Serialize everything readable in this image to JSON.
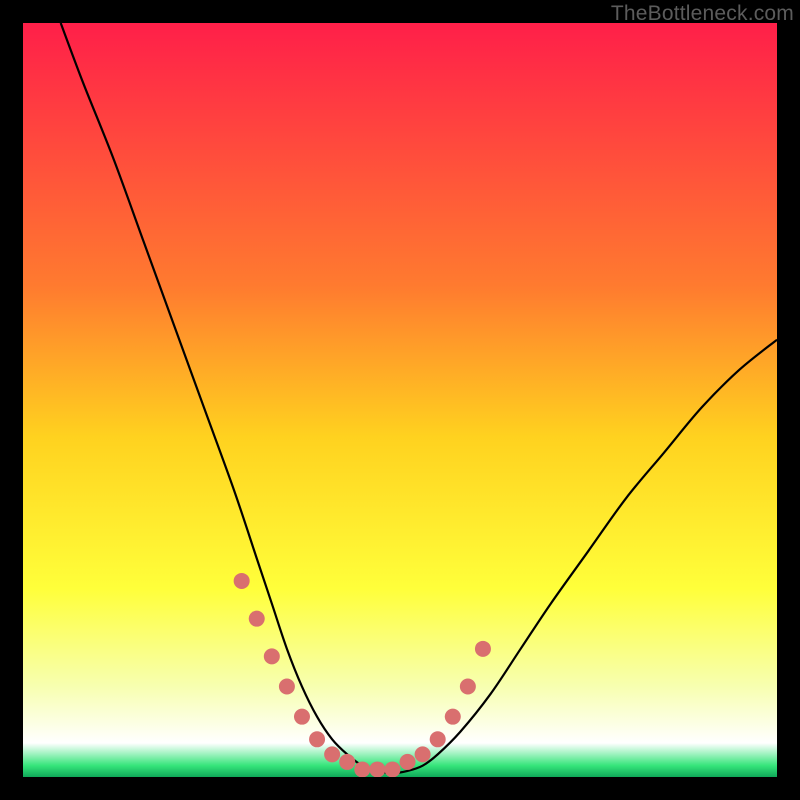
{
  "watermark": "TheBottleneck.com",
  "chart_data": {
    "type": "line",
    "title": "",
    "xlabel": "",
    "ylabel": "",
    "xlim": [
      0,
      100
    ],
    "ylim": [
      0,
      100
    ],
    "background_gradient": {
      "stops": [
        {
          "offset": 0.0,
          "color": "#ff1f49"
        },
        {
          "offset": 0.35,
          "color": "#ff7b2f"
        },
        {
          "offset": 0.55,
          "color": "#ffd21f"
        },
        {
          "offset": 0.75,
          "color": "#ffff3a"
        },
        {
          "offset": 0.88,
          "color": "#f7ffb0"
        },
        {
          "offset": 0.955,
          "color": "#ffffff"
        },
        {
          "offset": 0.985,
          "color": "#35e57a"
        },
        {
          "offset": 1.0,
          "color": "#0fa858"
        }
      ]
    },
    "curve": {
      "comment": "V-shaped bottleneck curve; y is relative bottleneck severity (100=top of chart, 0=bottom). Values estimated from pixel positions.",
      "x": [
        5,
        8,
        12,
        16,
        20,
        24,
        28,
        31,
        33,
        35,
        37,
        39,
        41,
        43,
        45,
        47,
        49,
        51,
        53,
        55,
        58,
        62,
        66,
        70,
        75,
        80,
        85,
        90,
        95,
        100
      ],
      "y": [
        100,
        92,
        82,
        71,
        60,
        49,
        38,
        29,
        23,
        17,
        12,
        8,
        5,
        3,
        1.5,
        0.8,
        0.5,
        0.8,
        1.5,
        3,
        6,
        11,
        17,
        23,
        30,
        37,
        43,
        49,
        54,
        58
      ]
    },
    "markers": {
      "comment": "Salmon dots clustered near the valley on both sides.",
      "x": [
        29,
        31,
        33,
        35,
        37,
        39,
        41,
        43,
        45,
        47,
        49,
        51,
        53,
        55,
        57,
        59,
        61
      ],
      "y": [
        26,
        21,
        16,
        12,
        8,
        5,
        3,
        2,
        1,
        1,
        1,
        2,
        3,
        5,
        8,
        12,
        17
      ],
      "color": "#d96f6f",
      "radius": 8
    }
  }
}
